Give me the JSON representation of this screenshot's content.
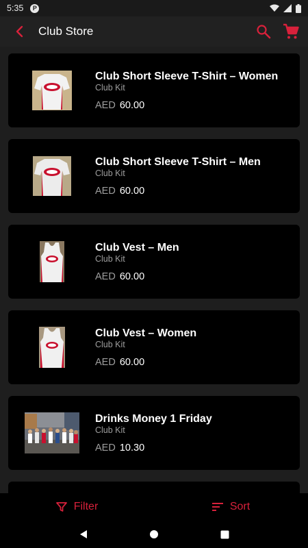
{
  "status_bar": {
    "time": "5:35"
  },
  "app_bar": {
    "title": "Club Store"
  },
  "colors": {
    "accent": "#d8213b",
    "card": "#000000",
    "background": "#1e1e1e",
    "secondary_text": "#9e9e9e"
  },
  "products": [
    {
      "name": "Club Short Sleeve T-Shirt – Women",
      "category": "Club Kit",
      "currency": "AED",
      "price": "60.00",
      "image": "tshirt-women"
    },
    {
      "name": "Club Short Sleeve T-Shirt – Men",
      "category": "Club Kit",
      "currency": "AED",
      "price": "60.00",
      "image": "tshirt-men"
    },
    {
      "name": "Club Vest – Men",
      "category": "Club Kit",
      "currency": "AED",
      "price": "60.00",
      "image": "vest-men"
    },
    {
      "name": "Club Vest – Women",
      "category": "Club Kit",
      "currency": "AED",
      "price": "60.00",
      "image": "vest-women"
    },
    {
      "name": "Drinks Money 1 Friday",
      "category": "Club Kit",
      "currency": "AED",
      "price": "10.30",
      "image": "group-photo"
    }
  ],
  "bottom_bar": {
    "filter_label": "Filter",
    "sort_label": "Sort"
  },
  "icons": [
    "back-arrow-icon",
    "search-icon",
    "cart-icon",
    "filter-icon",
    "sort-icon",
    "nav-back-icon",
    "nav-home-icon",
    "nav-recents-icon"
  ]
}
